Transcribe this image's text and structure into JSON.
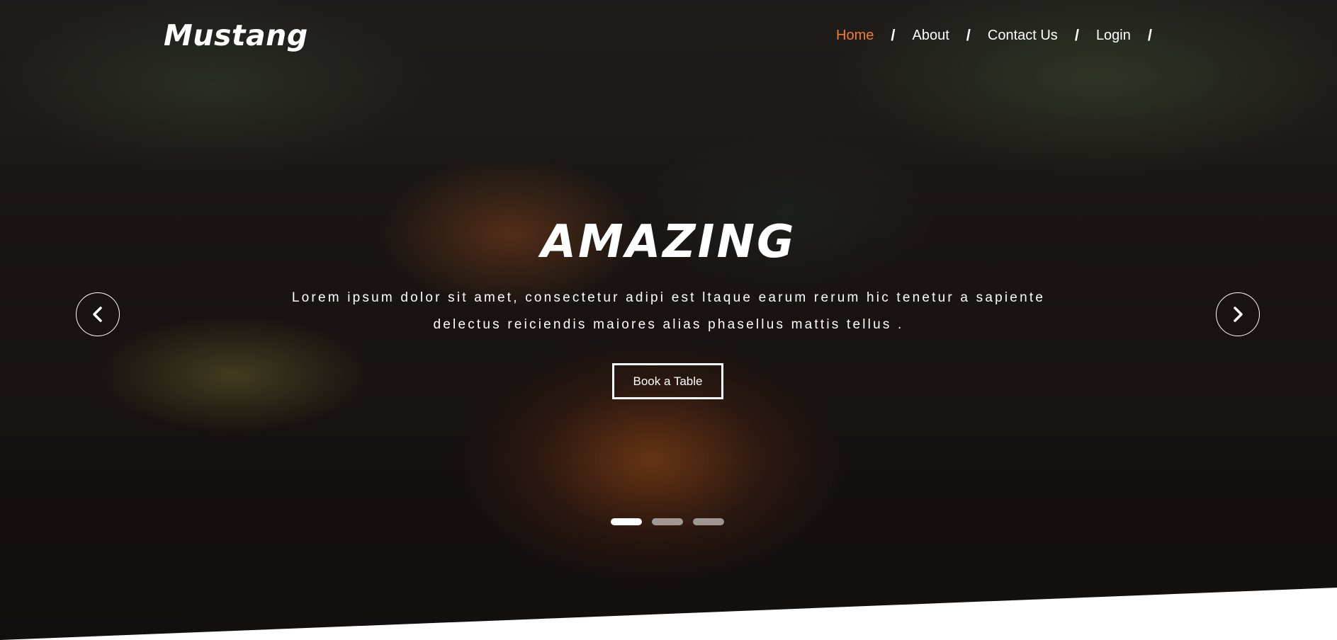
{
  "brand": {
    "logo_text": "Mustang"
  },
  "nav": {
    "items": [
      {
        "label": "Home",
        "active": true
      },
      {
        "label": "About",
        "active": false
      },
      {
        "label": "Contact Us",
        "active": false
      },
      {
        "label": "Login",
        "active": false
      }
    ],
    "separator": "/"
  },
  "hero": {
    "headline": "AMAZING",
    "subtext": "Lorem ipsum dolor sit amet, consectetur adipi est ltaque earum rerum hic tenetur a sapiente delectus reiciendis maiores alias phasellus mattis tellus .",
    "cta_label": "Book a Table"
  },
  "carousel": {
    "prev_icon": "chevron-left-icon",
    "next_icon": "chevron-right-icon",
    "slide_count": 3,
    "active_slide": 1
  },
  "colors": {
    "accent": "#f27d2a",
    "text": "#ffffff"
  }
}
